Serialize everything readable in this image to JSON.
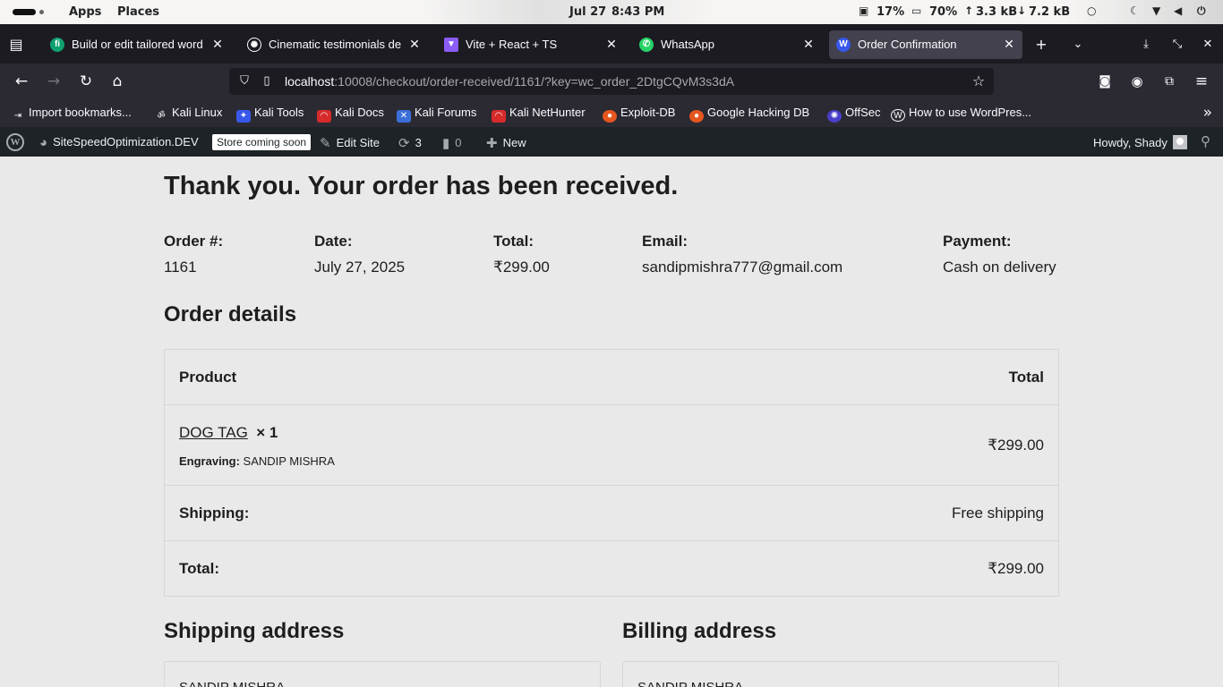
{
  "system_bar": {
    "apps": "Apps",
    "places": "Places",
    "date": "Jul 27",
    "time": "8:43 PM",
    "cpu": "17%",
    "memory": "70%",
    "upload": "3.3 kB",
    "download": "7.2 kB"
  },
  "tabs": [
    {
      "title": "Build or edit tailored word",
      "icon": "fi",
      "color": "#0e9f6e"
    },
    {
      "title": "Cinematic testimonials de",
      "icon": "openai-icon",
      "color": "#1c1b22"
    },
    {
      "title": "Vite + React + TS",
      "icon": "vite-icon",
      "color": "#8b5cf6"
    },
    {
      "title": "WhatsApp",
      "icon": "whatsapp-icon",
      "color": "#25d366"
    },
    {
      "title": "Order Confirmation",
      "icon": "wordpress-icon",
      "color": "#3858e9"
    }
  ],
  "url": {
    "host": "localhost",
    "path": ":10008/checkout/order-received/1161/?key=wc_order_2DtgCQvM3s3dA"
  },
  "bookmarks": [
    {
      "label": "Import bookmarks...",
      "icon": "import-icon",
      "color": "#2b2a33"
    },
    {
      "label": "Kali Linux",
      "icon": "kali-icon",
      "color": "#2b2a33"
    },
    {
      "label": "Kali Tools",
      "icon": "kali-tools-icon",
      "color": "#3858e9"
    },
    {
      "label": "Kali Docs",
      "icon": "kali-docs-icon",
      "color": "#d72b2b"
    },
    {
      "label": "Kali Forums",
      "icon": "kali-forums-icon",
      "color": "#3b6fd8"
    },
    {
      "label": "Kali NetHunter",
      "icon": "nethunter-icon",
      "color": "#d72b2b"
    },
    {
      "label": "Exploit-DB",
      "icon": "exploitdb-icon",
      "color": "#e5571f"
    },
    {
      "label": "Google Hacking DB",
      "icon": "ghdb-icon",
      "color": "#e5571f"
    },
    {
      "label": "OffSec",
      "icon": "offsec-icon",
      "color": "#4a3fc8"
    },
    {
      "label": "How to use WordPres...",
      "icon": "wordpress-icon",
      "color": "#2b2a33"
    }
  ],
  "wp_admin_bar": {
    "site_name": "SiteSpeedOptimization.DEV",
    "store_badge": "Store coming soon",
    "edit_site": "Edit Site",
    "updates_count": "3",
    "comments_count": "0",
    "new": "New",
    "howdy": "Howdy, Shady"
  },
  "page": {
    "heading": "Thank you. Your order has been received.",
    "overview": [
      {
        "label": "Order #:",
        "value": "1161"
      },
      {
        "label": "Date:",
        "value": "July 27, 2025"
      },
      {
        "label": "Total:",
        "value": "₹299.00"
      },
      {
        "label": "Email:",
        "value": "sandipmishra777@gmail.com"
      },
      {
        "label": "Payment:",
        "value": "Cash on delivery"
      }
    ],
    "order_details_heading": "Order details",
    "table": {
      "header_product": "Product",
      "header_total": "Total",
      "item": {
        "name": "DOG TAG",
        "qty": "× 1",
        "engraving_label": "Engraving:",
        "engraving_value": "SANDIP MISHRA",
        "total": "₹299.00"
      },
      "shipping_label": "Shipping:",
      "shipping_value": "Free shipping",
      "total_label": "Total:",
      "total_value": "₹299.00"
    },
    "shipping_address_heading": "Shipping address",
    "billing_address_heading": "Billing address",
    "shipping_name": "SANDIP MISHRA",
    "billing_name": "SANDIP MISHRA"
  }
}
